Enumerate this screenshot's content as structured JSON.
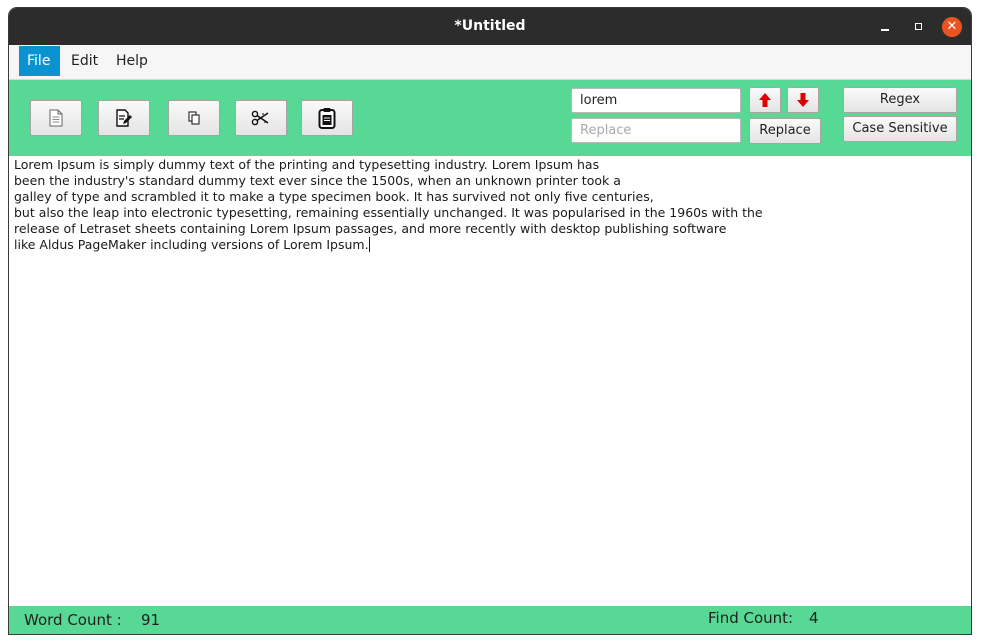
{
  "window": {
    "title": "*Untitled",
    "controls": {
      "minimize": "minimize-icon",
      "maximize": "maximize-icon",
      "close": "close-icon"
    }
  },
  "menu": {
    "items": [
      "File",
      "Edit",
      "Help"
    ],
    "active": "File"
  },
  "toolbar": {
    "icons": [
      "new-document-icon",
      "save-document-icon",
      "copy-icon",
      "cut-icon",
      "paste-icon"
    ],
    "search": {
      "value": "lorem",
      "prev_icon": "arrow-up-icon",
      "next_icon": "arrow-down-icon"
    },
    "replace": {
      "placeholder": "Replace",
      "button": "Replace"
    },
    "options": {
      "regex": "Regex",
      "case_sensitive": "Case Sensitive"
    },
    "colors": {
      "background": "#57d995",
      "arrow": "#e00000"
    }
  },
  "editor": {
    "lines": [
      "Lorem Ipsum is simply dummy text of the printing and typesetting industry. Lorem Ipsum has",
      "been the industry's standard dummy text ever since the 1500s, when an unknown printer took a",
      "galley of type and scrambled it to make a type specimen book. It has survived not only five centuries,",
      "but also the leap into electronic typesetting, remaining essentially unchanged. It was popularised in the 1960s with the",
      "release of Letraset sheets containing Lorem Ipsum passages, and more recently with desktop publishing software",
      "like Aldus PageMaker including versions of Lorem Ipsum."
    ]
  },
  "status": {
    "word_count_label": "Word Count :",
    "word_count": "91",
    "find_count_label": "Find Count:",
    "find_count": "4"
  }
}
